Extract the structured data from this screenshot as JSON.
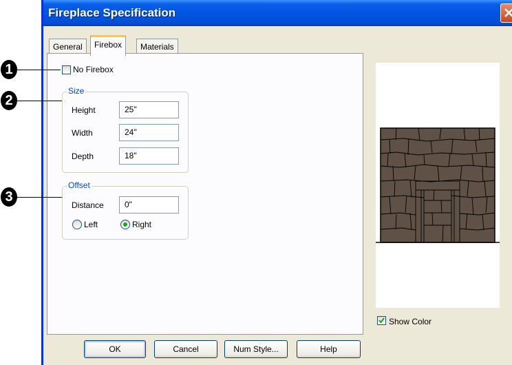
{
  "window": {
    "title": "Fireplace Specification"
  },
  "tabs": [
    {
      "label": "General",
      "active": false
    },
    {
      "label": "Firebox",
      "active": true
    },
    {
      "label": "Materials",
      "active": false
    }
  ],
  "firebox": {
    "no_firebox_label": "No Firebox",
    "no_firebox_checked": false,
    "size": {
      "legend": "Size",
      "height_label": "Height",
      "height_value": "25\"",
      "width_label": "Width",
      "width_value": "24\"",
      "depth_label": "Depth",
      "depth_value": "18\""
    },
    "offset": {
      "legend": "Offset",
      "distance_label": "Distance",
      "distance_value": "0\"",
      "left_label": "Left",
      "right_label": "Right",
      "selected": "Right"
    }
  },
  "preview": {
    "show_color_label": "Show Color",
    "show_color_checked": true,
    "stone_color": "#5f5146"
  },
  "callouts": [
    "1",
    "2",
    "3"
  ],
  "buttons": {
    "ok": "OK",
    "cancel": "Cancel",
    "num_style": "Num Style...",
    "help": "Help"
  }
}
